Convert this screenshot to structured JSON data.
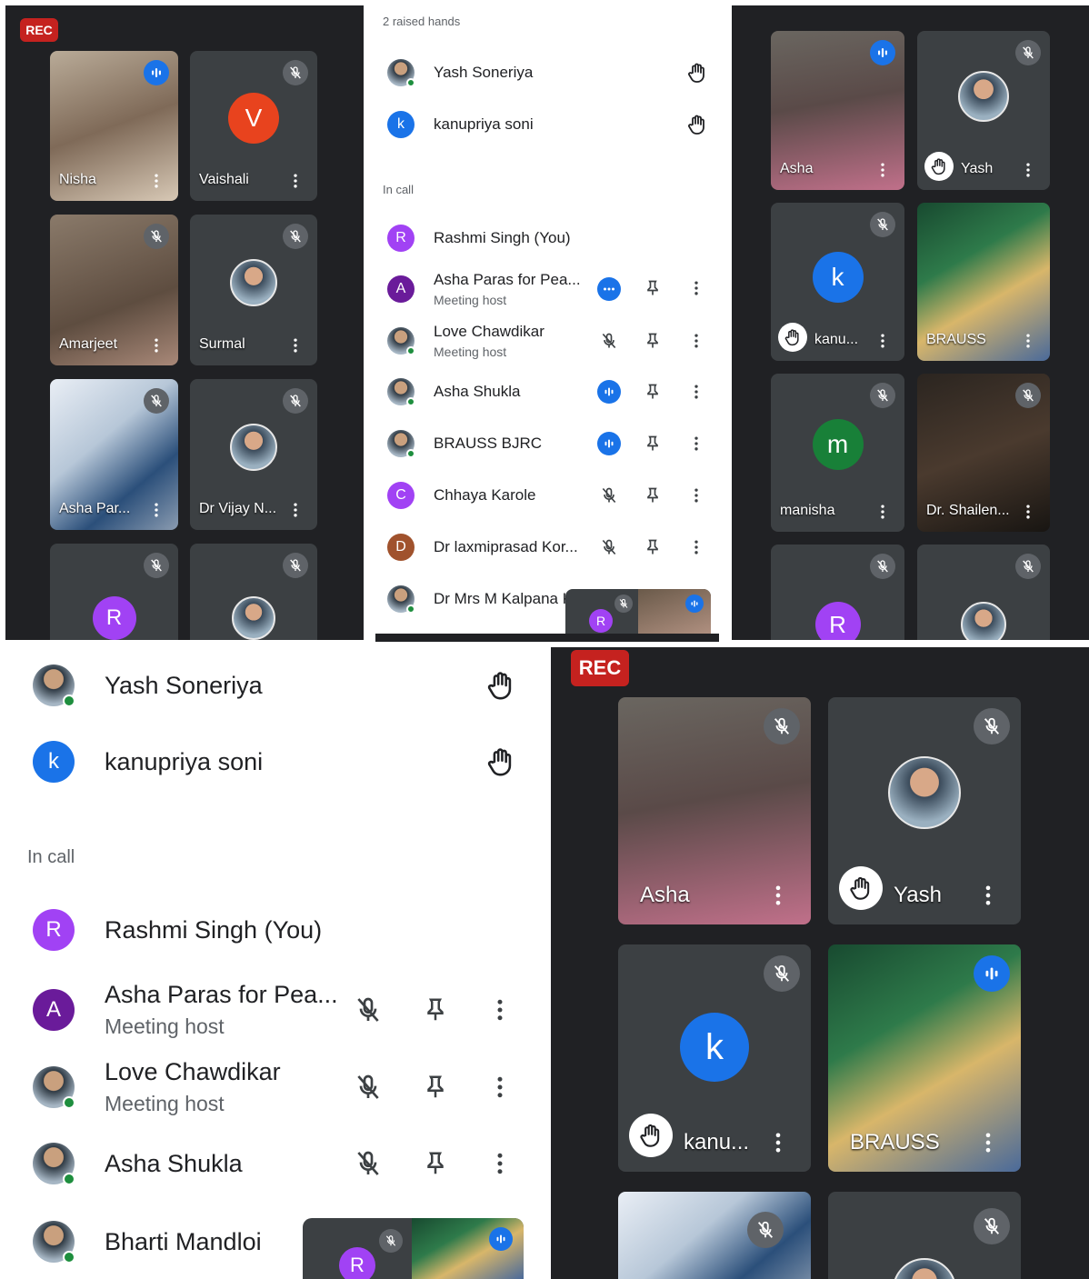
{
  "panel_tl": {
    "rec": "REC",
    "tiles": [
      {
        "name": "Nisha"
      },
      {
        "name": "Vaishali",
        "initial": "V"
      },
      {
        "name": "Amarjeet"
      },
      {
        "name": "Surmal"
      },
      {
        "name": "Asha Par..."
      },
      {
        "name": "Dr Vijay N..."
      },
      {
        "initial": "R"
      }
    ]
  },
  "panel_tm": {
    "raised_header": "2 raised hands",
    "raised": [
      {
        "name": "Yash Soneriya"
      },
      {
        "name": "kanupriya soni",
        "initial": "k"
      }
    ],
    "in_call_header": "In call",
    "people": [
      {
        "name": "Rashmi Singh (You)",
        "initial": "R"
      },
      {
        "name": "Asha Paras for Pea...",
        "sub": "Meeting host",
        "initial": "A"
      },
      {
        "name": "Love Chawdikar",
        "sub": "Meeting host"
      },
      {
        "name": "Asha Shukla"
      },
      {
        "name": "BRAUSS BJRC"
      },
      {
        "name": "Chhaya Karole",
        "initial": "C"
      },
      {
        "name": "Dr laxmiprasad Kor...",
        "initial": "D"
      },
      {
        "name": "Dr Mrs M Kalpana K"
      }
    ],
    "pip_initial": "R"
  },
  "panel_tr": {
    "tiles": [
      {
        "name": "Asha"
      },
      {
        "name": "Yash"
      },
      {
        "name": "kanu...",
        "initial": "k"
      },
      {
        "name": "BRAUSS"
      },
      {
        "name": "manisha",
        "initial": "m"
      },
      {
        "name": "Dr. Shailen..."
      },
      {
        "initial": "R"
      }
    ]
  },
  "panel_bl": {
    "raised": [
      {
        "name": "Yash Soneriya"
      },
      {
        "name": "kanupriya soni",
        "initial": "k"
      }
    ],
    "in_call_header": "In call",
    "people": [
      {
        "name": "Rashmi Singh (You)",
        "initial": "R"
      },
      {
        "name": "Asha Paras for Pea...",
        "sub": "Meeting host",
        "initial": "A"
      },
      {
        "name": "Love Chawdikar",
        "sub": "Meeting host"
      },
      {
        "name": "Asha Shukla"
      },
      {
        "name": "Bharti Mandloi"
      }
    ],
    "pip_initial": "R"
  },
  "panel_br": {
    "rec": "REC",
    "tiles": [
      {
        "name": "Asha"
      },
      {
        "name": "Yash"
      },
      {
        "name": "kanu...",
        "initial": "k"
      },
      {
        "name": "BRAUSS"
      }
    ]
  },
  "colors": {
    "purple": "#a142f4",
    "blue": "#1a73e8",
    "orange": "#e8431e",
    "green": "#188038",
    "brown": "#a0522d"
  },
  "icons": [
    "mic-off-icon",
    "speaking-icon",
    "raised-hand-icon",
    "pin-icon",
    "more-vert-icon",
    "more-horiz-icon"
  ]
}
